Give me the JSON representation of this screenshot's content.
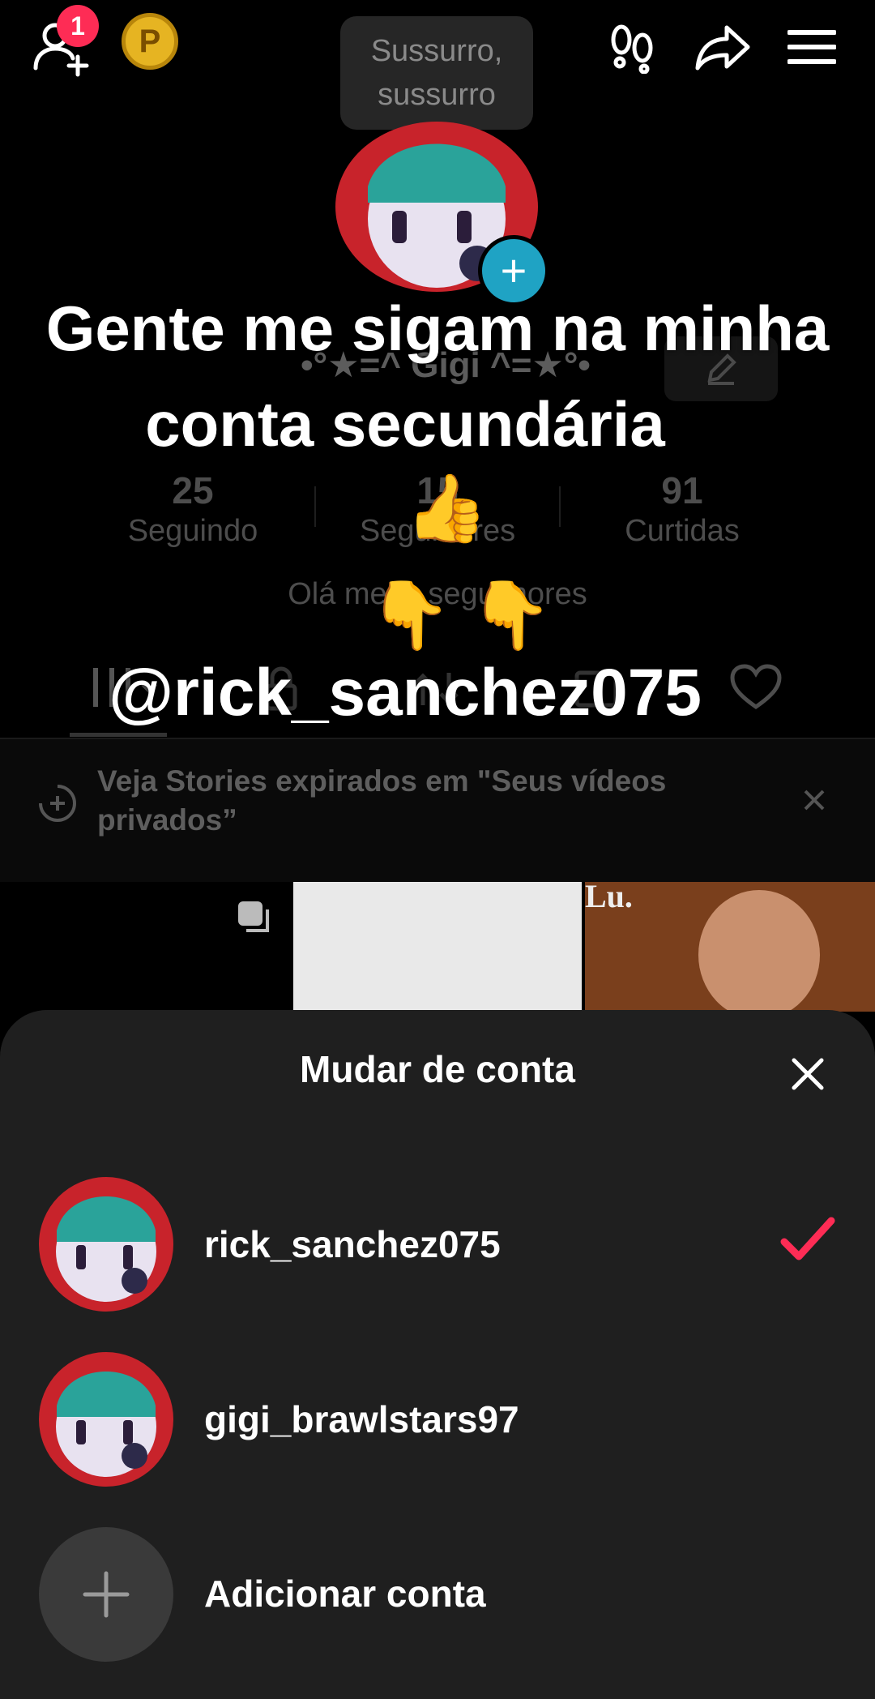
{
  "topbar": {
    "notification_count": "1",
    "coin_letter": "P",
    "tooltip": "Sussurro, sussurro"
  },
  "overlay": {
    "line1": "Gente me sigam na minha",
    "line2": "conta secundária",
    "emoji_thumbs": "👍",
    "emoji_point": "👇 👇",
    "handle": "@rick_sanchez075"
  },
  "profile": {
    "display_name": "•°★=^ Gigi ^=★°•",
    "stats": [
      {
        "value": "25",
        "label": "Seguindo"
      },
      {
        "value": "15",
        "label": "Seguidores"
      },
      {
        "value": "91",
        "label": "Curtidas"
      }
    ],
    "bio": "Olá meus seguimores"
  },
  "banner": {
    "text": "Veja Stories expirados em \"Seus vídeos privados”"
  },
  "video_thumb_caption": "Lu.",
  "sheet": {
    "title": "Mudar de conta",
    "accounts": [
      {
        "username": "rick_sanchez075",
        "selected": true
      },
      {
        "username": "gigi_brawlstars97",
        "selected": false
      }
    ],
    "add_account": "Adicionar conta"
  },
  "colors": {
    "accent": "#fe2c55",
    "sheet_bg": "#1f1f1f",
    "plus_badge": "#1fa3c4"
  },
  "icons": [
    "add-user-icon",
    "coin-icon",
    "footprints-icon",
    "share-icon",
    "menu-icon",
    "edit-icon",
    "grid-icon",
    "lock-icon",
    "repost-icon",
    "bookmark-icon",
    "heart-icon",
    "story-icon",
    "close-icon",
    "multi-video-icon",
    "checkmark-icon",
    "plus-icon"
  ]
}
